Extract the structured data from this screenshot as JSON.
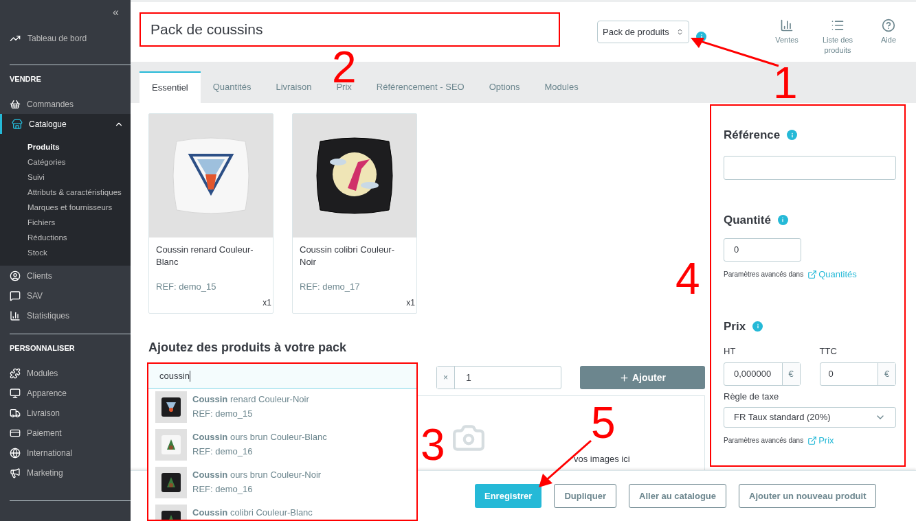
{
  "sidebar": {
    "collapse": "«",
    "dashboard": {
      "label": "Tableau de bord",
      "selected": false
    },
    "sections": [
      {
        "title": "VENDRE",
        "items": [
          {
            "label": "Commandes",
            "selected": false
          },
          {
            "label": "Catalogue",
            "selected": true,
            "expanded": true,
            "children": [
              {
                "label": "Produits",
                "selected": true
              },
              {
                "label": "Catégories",
                "selected": false
              },
              {
                "label": "Suivi",
                "selected": false
              },
              {
                "label": "Attributs & caractéristiques",
                "selected": false
              },
              {
                "label": "Marques et fournisseurs",
                "selected": false
              },
              {
                "label": "Fichiers",
                "selected": false
              },
              {
                "label": "Réductions",
                "selected": false
              },
              {
                "label": "Stock",
                "selected": false
              }
            ]
          },
          {
            "label": "Clients",
            "selected": false
          },
          {
            "label": "SAV",
            "selected": false
          },
          {
            "label": "Statistiques",
            "selected": false
          }
        ]
      },
      {
        "title": "PERSONNALISER",
        "items": [
          {
            "label": "Modules",
            "selected": false
          },
          {
            "label": "Apparence",
            "selected": false
          },
          {
            "label": "Livraison",
            "selected": false
          },
          {
            "label": "Paiement",
            "selected": false
          },
          {
            "label": "International",
            "selected": false
          },
          {
            "label": "Marketing",
            "selected": false
          }
        ]
      }
    ]
  },
  "header": {
    "product_name": "Pack de coussins",
    "type_select": "Pack de produits",
    "toolbar": [
      {
        "label": "Ventes"
      },
      {
        "label": "Liste des produits"
      },
      {
        "label": "Aide"
      }
    ]
  },
  "tabs": [
    {
      "label": "Essentiel",
      "selected": true
    },
    {
      "label": "Quantités",
      "selected": false
    },
    {
      "label": "Livraison",
      "selected": false
    },
    {
      "label": "Prix",
      "selected": false
    },
    {
      "label": "Référencement - SEO",
      "selected": false
    },
    {
      "label": "Options",
      "selected": false
    },
    {
      "label": "Modules",
      "selected": false
    }
  ],
  "pack_items": [
    {
      "kind": "picture",
      "name": "Coussin renard Couleur-Blanc",
      "ref": "REF: demo_15",
      "qty": "x1"
    },
    {
      "kind": "picture",
      "name": "Coussin colibri Couleur-Noir",
      "ref": "REF: demo_17",
      "qty": "x1"
    }
  ],
  "add_products": {
    "title": "Ajoutez des produits à votre pack",
    "search_value": "coussin",
    "qty_prefix": "×",
    "qty_value": "1",
    "add_button": "Ajouter",
    "suggestions": [
      {
        "kind": "picture",
        "name": "**Coussin** renard Couleur-Noir",
        "ref": "REF: demo_15"
      },
      {
        "kind": "picture",
        "name": "**Coussin** ours brun Couleur-Blanc",
        "ref": "REF: demo_16"
      },
      {
        "kind": "picture",
        "name": "**Coussin** ours brun Couleur-Noir",
        "ref": "REF: demo_16"
      },
      {
        "kind": "picture",
        "name": "**Coussin** colibri Couleur-Blanc"
      }
    ],
    "dropzone_text": "vos images ici"
  },
  "summary": {
    "reference": {
      "title": "Référence"
    },
    "quantity": {
      "title": "Quantité",
      "value": "0",
      "hint": "Paramètres avancés dans",
      "link": "Quantités"
    },
    "price": {
      "title": "Prix",
      "ht_label": "HT",
      "ht_value": "0,000000",
      "ttc_label": "TTC",
      "ttc_value": "0",
      "currency": "€",
      "tax_label": "Règle de taxe",
      "tax_value": "FR Taux standard (20%)",
      "hint": "Paramètres avancés dans",
      "link": "Prix"
    }
  },
  "footer": {
    "buttons": [
      {
        "label": "Enregistrer",
        "kind": "primary"
      },
      {
        "label": "Dupliquer",
        "kind": "outline"
      },
      {
        "label": "Aller au catalogue",
        "kind": "outline"
      },
      {
        "label": "Ajouter un nouveau produit",
        "kind": "outline"
      }
    ]
  },
  "annotations": [
    {
      "label": "1"
    },
    {
      "label": "2"
    },
    {
      "label": "3"
    },
    {
      "label": "4"
    },
    {
      "label": "5"
    }
  ]
}
